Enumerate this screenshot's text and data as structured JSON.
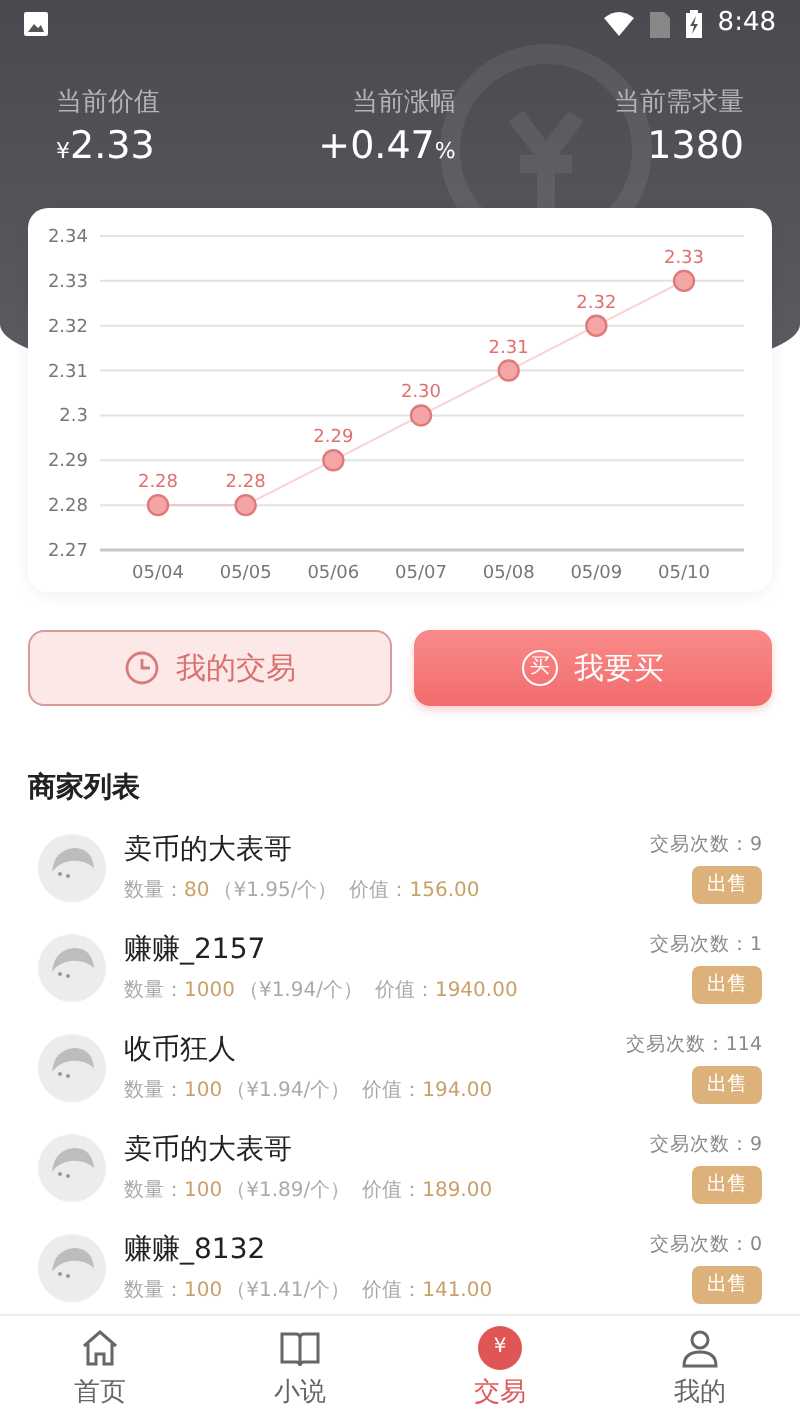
{
  "status_bar": {
    "time": "8:48"
  },
  "stats": [
    {
      "label": "当前价值",
      "prefix": "¥",
      "value": "2.33"
    },
    {
      "label": "当前涨幅",
      "value": "+0.47",
      "suffix": "%"
    },
    {
      "label": "当前需求量",
      "value": "1380"
    }
  ],
  "chart_data": {
    "type": "line",
    "categories": [
      "05/04",
      "05/05",
      "05/06",
      "05/07",
      "05/08",
      "05/09",
      "05/10"
    ],
    "grid": true,
    "series": [
      {
        "marker": "circle",
        "color": "#f4a5a5",
        "values": [
          2.28,
          2.28,
          2.29,
          2.3,
          2.31,
          2.32,
          2.33
        ]
      }
    ],
    "value_labels": [
      "2.28",
      "2.28",
      "2.29",
      "2.30",
      "2.31",
      "2.32",
      "2.33"
    ],
    "ylim": [
      2.27,
      2.34
    ],
    "yticks": [
      2.27,
      2.28,
      2.29,
      {
        "value": 2.3,
        "label": "2.3"
      },
      2.31,
      2.32,
      2.33,
      2.34
    ]
  },
  "actions": [
    {
      "label": "我的交易",
      "kind": "outline"
    },
    {
      "label": "我要买",
      "kind": "filled",
      "icon_text": "买"
    }
  ],
  "section_title": "商家列表",
  "merchants": [
    {
      "name": "卖币的大表哥",
      "quantity_label": "数量：",
      "quantity": "80",
      "unit_price": "（¥1.95/个）",
      "value_label": "价值：",
      "value": "156.00",
      "trades": "交易次数：9",
      "action": "出售"
    },
    {
      "name": "赚赚_2157",
      "quantity_label": "数量：",
      "quantity": "1000",
      "unit_price": "（¥1.94/个）",
      "value_label": "价值：",
      "value": "1940.00",
      "trades": "交易次数：1",
      "action": "出售"
    },
    {
      "name": "收币狂人",
      "quantity_label": "数量：",
      "quantity": "100",
      "unit_price": "（¥1.94/个）",
      "value_label": "价值：",
      "value": "194.00",
      "trades": "交易次数：114",
      "action": "出售"
    },
    {
      "name": "卖币的大表哥",
      "quantity_label": "数量：",
      "quantity": "100",
      "unit_price": "（¥1.89/个）",
      "value_label": "价值：",
      "value": "189.00",
      "trades": "交易次数：9",
      "action": "出售"
    },
    {
      "name": "赚赚_8132",
      "quantity_label": "数量：",
      "quantity": "100",
      "unit_price": "（¥1.41/个）",
      "value_label": "价值：",
      "value": "141.00",
      "trades": "交易次数：0",
      "action": "出售"
    }
  ],
  "nav": [
    {
      "label": "首页",
      "selected": false
    },
    {
      "label": "小说",
      "selected": false
    },
    {
      "label": "交易",
      "icon_text": "¥",
      "selected": true
    },
    {
      "label": "我的",
      "selected": false
    }
  ]
}
